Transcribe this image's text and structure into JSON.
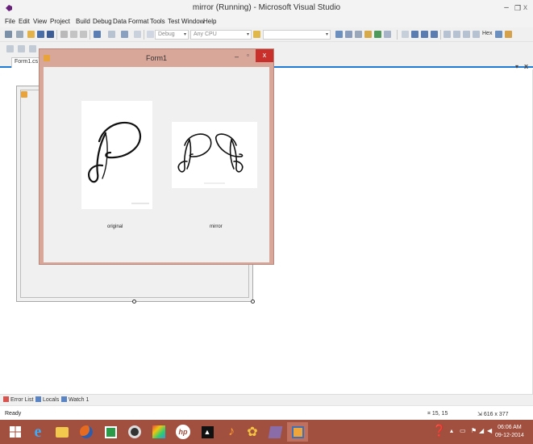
{
  "window": {
    "title": "mirror (Running) - Microsoft Visual Studio",
    "minimize": "–",
    "maximize": "❐",
    "close": "x"
  },
  "menu": [
    "File",
    "Edit",
    "View",
    "Project",
    "Build",
    "Debug",
    "Data",
    "Format",
    "Tools",
    "Test",
    "Window",
    "Help"
  ],
  "toolbar": {
    "config": "Debug",
    "platform": "Any CPU",
    "hex_label": "Hex"
  },
  "doc_tab": {
    "label": "Form1.cs ["
  },
  "form1": {
    "title": "Form1",
    "minimize": "–",
    "maximize": "▫",
    "close": "x",
    "caption_original": "original",
    "caption_mirror": "mirror"
  },
  "bottom_tabs": [
    "Error List",
    "Locals",
    "Watch 1"
  ],
  "status": {
    "text": "Ready",
    "position": "15, 15",
    "size": "616 x 377"
  },
  "clock": {
    "time": "06:06 AM",
    "date": "09-12-2014"
  },
  "colors": {
    "taskbar": "#a14f3e",
    "form_border": "#d9a79a",
    "close_red": "#c9302c",
    "accent_blue": "#1e7ad4"
  },
  "taskbar_icons": [
    "windows-start",
    "internet-explorer",
    "file-explorer",
    "firefox",
    "store",
    "media",
    "paint",
    "hp",
    "terminal",
    "music",
    "sound",
    "visual-studio",
    "form-app"
  ]
}
